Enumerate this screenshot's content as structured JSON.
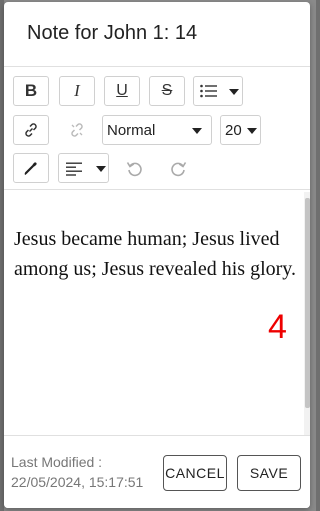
{
  "dialog": {
    "title": "Note for John 1: 14"
  },
  "toolbar": {
    "bold_icon": "bold-icon",
    "italic_icon": "italic-icon",
    "underline_icon": "underline-icon",
    "strike_icon": "strikethrough-icon",
    "list_icon": "bulleted-list-icon",
    "link_icon": "link-icon",
    "unlink_icon": "unlink-icon",
    "paragraph_style": "Normal",
    "font_size": "20",
    "color_icon": "eyedropper-icon",
    "align_icon": "align-left-icon",
    "undo_icon": "undo-icon",
    "redo_icon": "redo-icon"
  },
  "editor": {
    "text": "Jesus became human; Jesus lived among us; Jesus revealed his glory.",
    "verse_number": "4",
    "verse_number_color": "#ee0000"
  },
  "footer": {
    "last_modified_label": "Last Modified :",
    "last_modified_value": "22/05/2024, 15:17:51",
    "cancel_label": "CANCEL",
    "save_label": "SAVE"
  }
}
